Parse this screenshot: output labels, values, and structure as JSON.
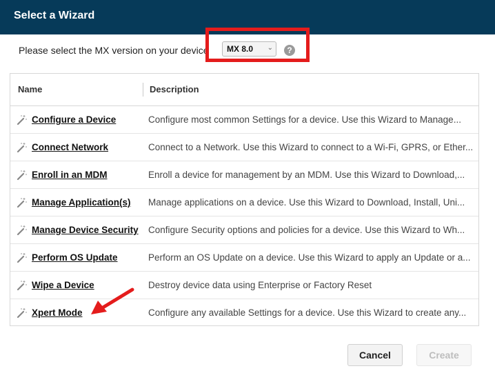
{
  "dialog": {
    "title": "Select a Wizard"
  },
  "version": {
    "label": "Please select the MX version on your device",
    "selected": "MX 8.0",
    "help_icon": "?"
  },
  "table": {
    "columns": [
      "Name",
      "Description"
    ],
    "rows": [
      {
        "name": "Configure a Device",
        "description": "Configure most common Settings for a device. Use this Wizard to Manage..."
      },
      {
        "name": "Connect Network",
        "description": "Connect to a Network. Use this Wizard to connect to a Wi-Fi, GPRS, or Ether..."
      },
      {
        "name": "Enroll in an MDM",
        "description": "Enroll a device for management by an MDM.  Use this Wizard to Download,..."
      },
      {
        "name": "Manage Application(s)",
        "description": "Manage applications on a device.  Use this Wizard to Download, Install, Uni..."
      },
      {
        "name": "Manage Device Security",
        "description": "Configure Security options and policies for a device.  Use this Wizard to Wh..."
      },
      {
        "name": "Perform OS Update",
        "description": "Perform an OS Update on a device.  Use this Wizard to apply an Update or a..."
      },
      {
        "name": "Wipe a Device",
        "description": "Destroy device data using Enterprise or Factory Reset"
      },
      {
        "name": "Xpert Mode",
        "description": "Configure any available Settings for a device. Use this Wizard to create any..."
      }
    ]
  },
  "buttons": {
    "cancel": "Cancel",
    "create": "Create"
  },
  "colors": {
    "titlebar": "#063a59",
    "annotation": "#e41c1c"
  },
  "icons": {
    "row_icon": "magic-wand-icon"
  }
}
